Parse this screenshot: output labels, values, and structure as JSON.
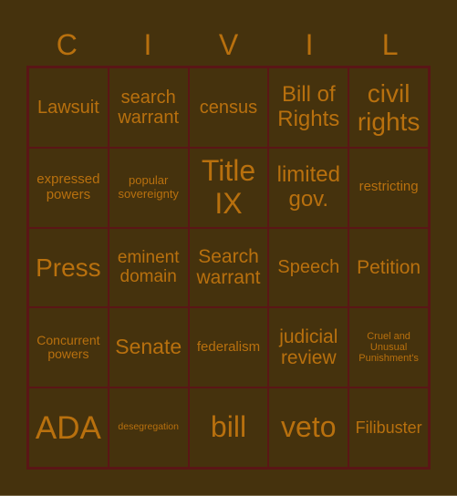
{
  "board": {
    "title_letters": [
      "C",
      "I",
      "V",
      "I",
      "L"
    ],
    "colors": {
      "background": "#45320d",
      "grid_line": "#5a1616",
      "text": "#b8700e"
    },
    "cells": [
      [
        "Lawsuit",
        "search warrant",
        "census",
        "Bill of Rights",
        "civil rights"
      ],
      [
        "expressed powers",
        "popular sovereignty",
        "Title IX",
        "limited gov.",
        "restricting"
      ],
      [
        "Press",
        "eminent domain",
        "Search warrant",
        "Speech",
        "Petition"
      ],
      [
        "Concurrent powers",
        "Senate",
        "federalism",
        "judicial review",
        "Cruel and Unusual Punishment's"
      ],
      [
        "ADA",
        "desegregation",
        "bill",
        "veto",
        "Filibuster"
      ]
    ]
  }
}
